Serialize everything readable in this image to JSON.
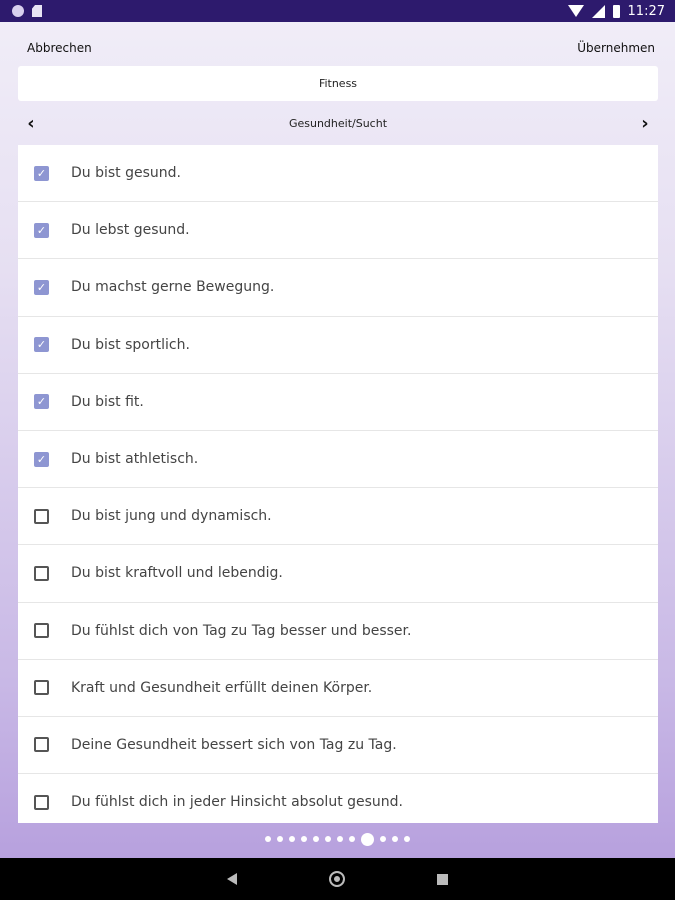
{
  "status_bar": {
    "time": "11:27"
  },
  "actions": {
    "cancel_label": "Abbrechen",
    "apply_label": "Übernehmen"
  },
  "category": {
    "title": "Fitness"
  },
  "section": {
    "title": "Gesundheit/Sucht",
    "prev_icon": "chevron-left-icon",
    "next_icon": "chevron-right-icon"
  },
  "items": [
    {
      "text": "Du bist gesund.",
      "checked": true
    },
    {
      "text": "Du lebst gesund.",
      "checked": true
    },
    {
      "text": "Du machst gerne Bewegung.",
      "checked": true
    },
    {
      "text": "Du bist sportlich.",
      "checked": true
    },
    {
      "text": "Du bist fit.",
      "checked": true
    },
    {
      "text": "Du bist athletisch.",
      "checked": true
    },
    {
      "text": "Du bist jung und dynamisch.",
      "checked": false
    },
    {
      "text": "Du bist kraftvoll und lebendig.",
      "checked": false
    },
    {
      "text": "Du fühlst dich von Tag zu Tag besser und besser.",
      "checked": false
    },
    {
      "text": "Kraft und Gesundheit erfüllt deinen Körper.",
      "checked": false
    },
    {
      "text": "Deine Gesundheit bessert sich von Tag zu Tag.",
      "checked": false
    },
    {
      "text": "Du fühlst dich in jeder Hinsicht absolut gesund.",
      "checked": false
    }
  ],
  "pager": {
    "count": 12,
    "active_index": 8
  },
  "colors": {
    "status_bar": "#2d1a6d",
    "checkbox_checked": "#8e96d2"
  }
}
